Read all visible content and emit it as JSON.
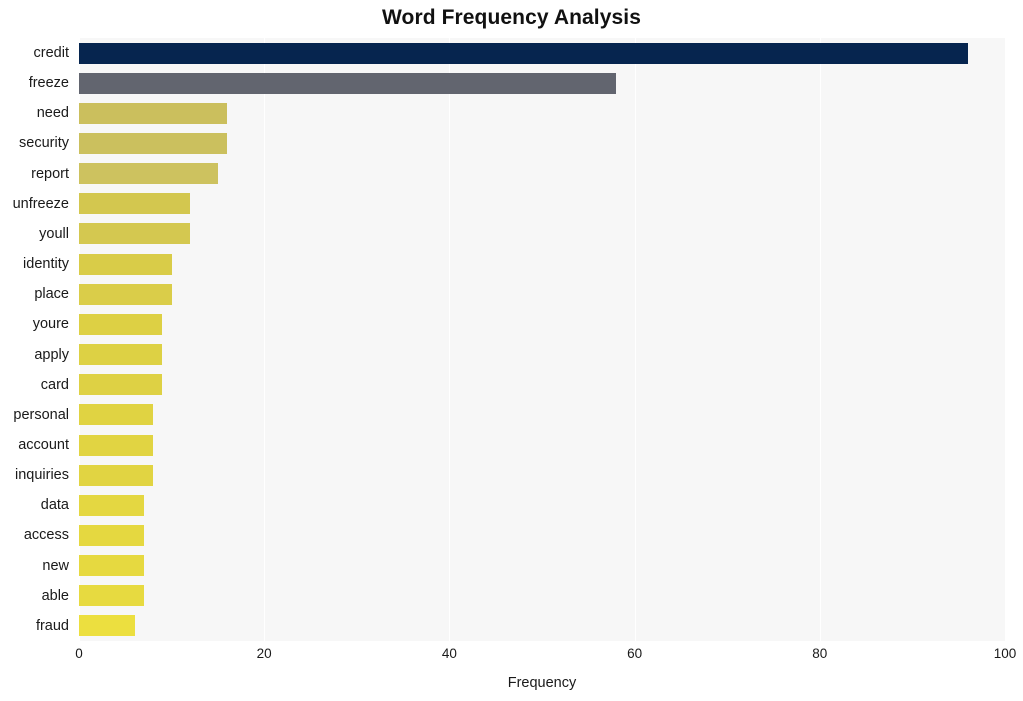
{
  "chart_data": {
    "type": "bar",
    "orientation": "horizontal",
    "title": "Word Frequency Analysis",
    "xlabel": "Frequency",
    "ylabel": "",
    "xlim": [
      0,
      100
    ],
    "xticks": [
      0,
      20,
      40,
      60,
      80,
      100
    ],
    "xtick_labels": [
      "0",
      "20",
      "40",
      "60",
      "80",
      "100"
    ],
    "grid": true,
    "grid_axis": "x",
    "legend": false,
    "categories": [
      "credit",
      "freeze",
      "need",
      "security",
      "report",
      "unfreeze",
      "youll",
      "identity",
      "place",
      "youre",
      "apply",
      "card",
      "personal",
      "account",
      "inquiries",
      "data",
      "access",
      "new",
      "able",
      "fraud"
    ],
    "values": [
      96,
      58,
      16,
      16,
      15,
      12,
      12,
      10,
      10,
      9,
      9,
      9,
      8,
      8,
      8,
      7,
      7,
      7,
      7,
      6
    ],
    "bar_colors": [
      "#06254f",
      "#62656f",
      "#cbbf5d",
      "#cbc05e",
      "#cdc25f",
      "#d3c74f",
      "#d4c850",
      "#d9cc48",
      "#dacd49",
      "#ddd044",
      "#ddd144",
      "#ded144",
      "#e0d342",
      "#e1d442",
      "#e1d442",
      "#e4d741",
      "#e5d840",
      "#e6d940",
      "#e7da40",
      "#ecdf3f"
    ],
    "plot_background": "#f7f7f7",
    "figure_background": "#ffffff",
    "gridline_color": "#ffffff"
  }
}
